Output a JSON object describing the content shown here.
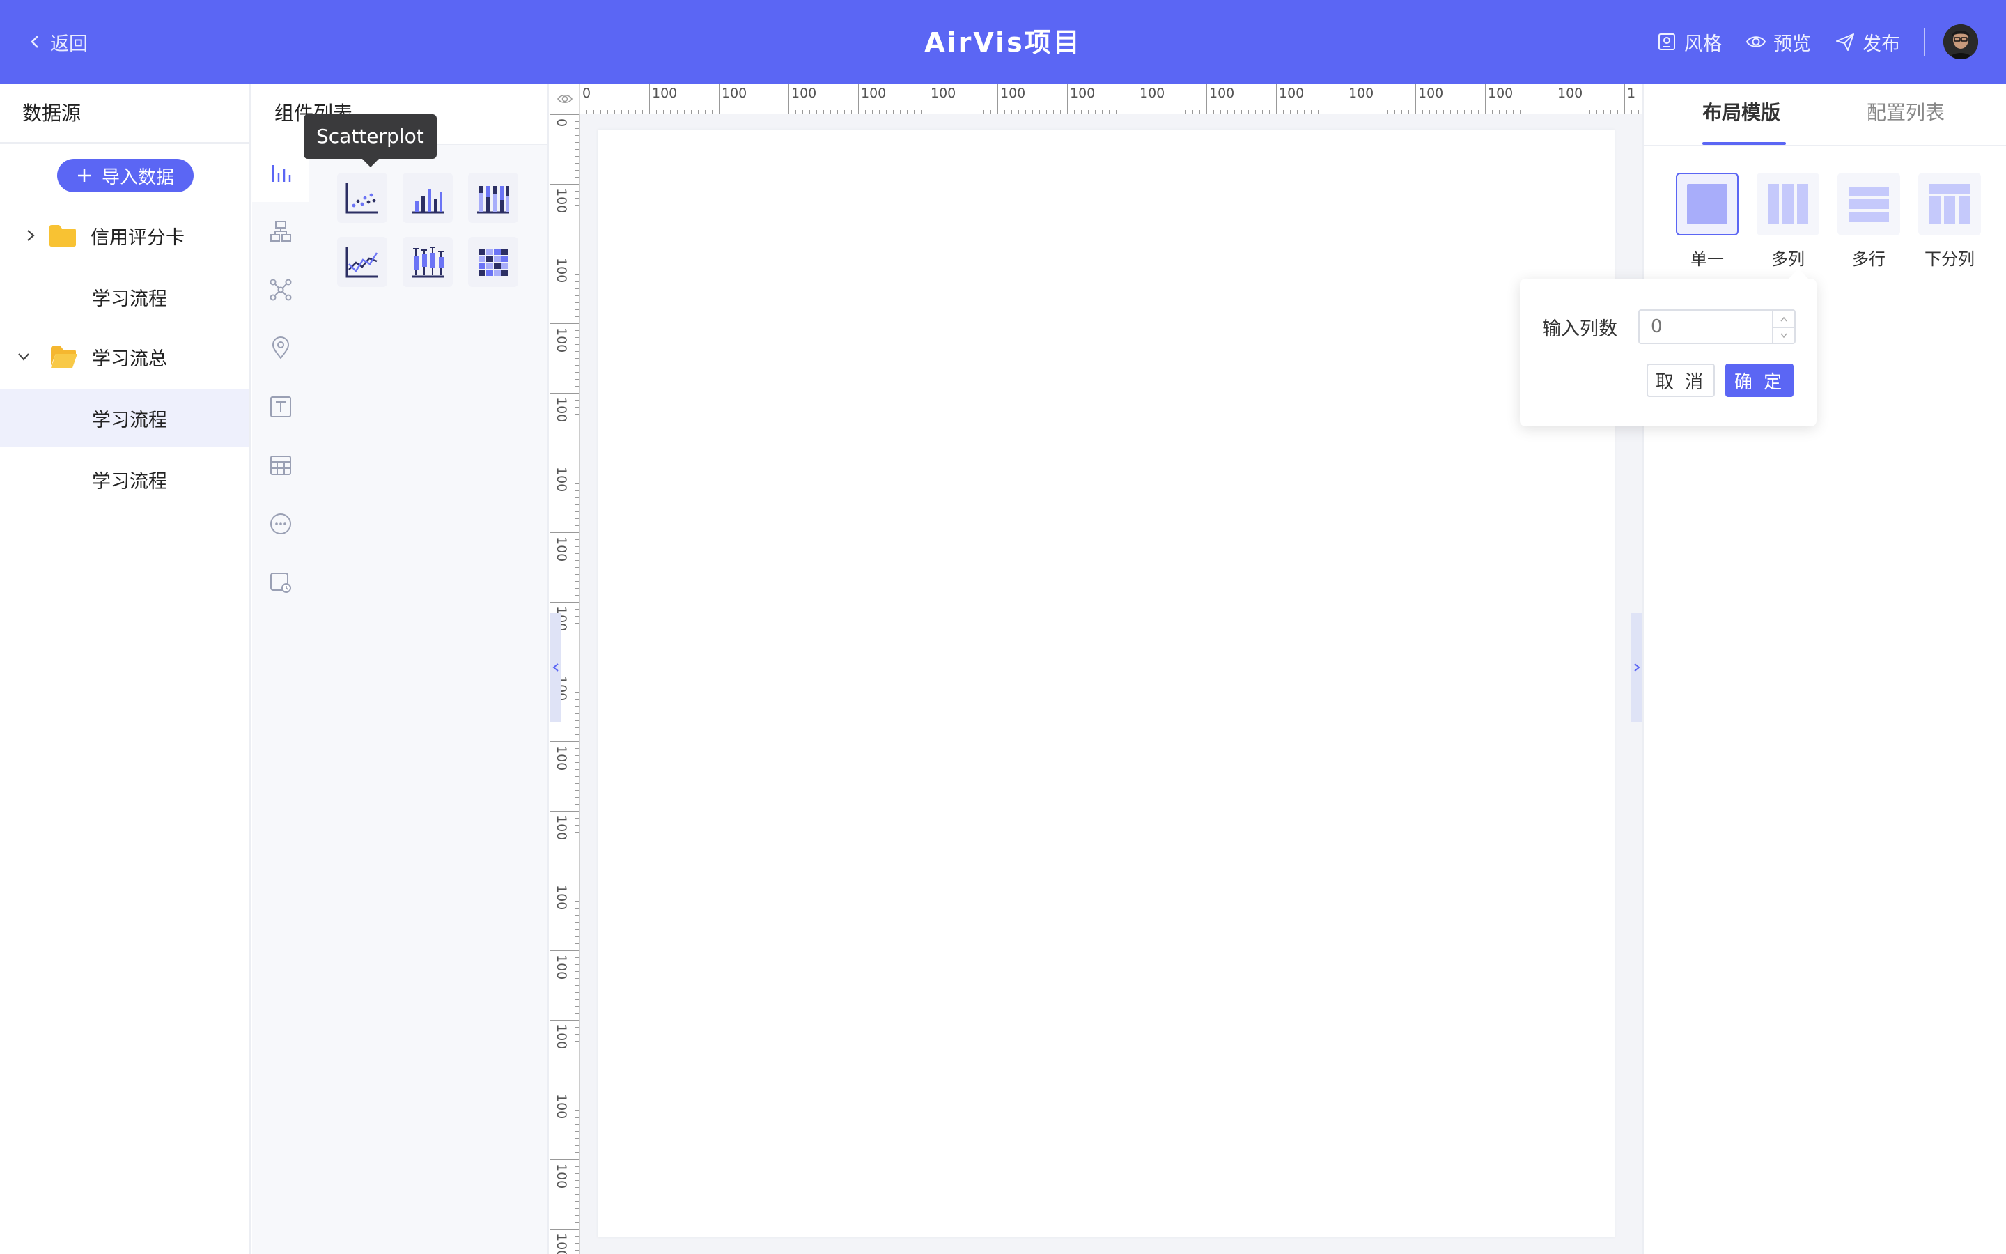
{
  "header": {
    "back_label": "返回",
    "title": "AirVis项目",
    "actions": [
      {
        "label": "风格",
        "icon": "style-icon"
      },
      {
        "label": "预览",
        "icon": "eye-icon"
      },
      {
        "label": "发布",
        "icon": "send-icon"
      }
    ],
    "accent_color": "#5b66f4"
  },
  "datasource": {
    "title": "数据源",
    "import_label": "导入数据",
    "tree": [
      {
        "label": "信用评分卡",
        "type": "folder",
        "expanded": false
      },
      {
        "label": "学习流程",
        "type": "item"
      },
      {
        "label": "学习流总",
        "type": "folder",
        "expanded": true
      },
      {
        "label": "学习流程",
        "type": "item",
        "selected": true
      },
      {
        "label": "学习流程",
        "type": "item"
      }
    ]
  },
  "components": {
    "title": "组件列表",
    "tooltip": "Scatterplot",
    "rail": [
      "bar-chart-icon",
      "hierarchy-icon",
      "network-icon",
      "map-pin-icon",
      "text-icon",
      "table-icon",
      "more-icon",
      "media-icon"
    ],
    "charts": [
      "scatterplot-icon",
      "bar-chart-icon",
      "stacked-bar-icon",
      "line-chart-icon",
      "boxplot-icon",
      "heatmap-icon"
    ]
  },
  "canvas": {
    "ruler_top_labels": [
      "0",
      "100",
      "100",
      "100",
      "100",
      "100",
      "100",
      "100",
      "100",
      "100",
      "100",
      "100",
      "100",
      "100",
      "100",
      "1"
    ],
    "ruler_left_labels": [
      "0",
      "100",
      "100",
      "100",
      "100",
      "100",
      "100",
      "100",
      "100",
      "100",
      "100",
      "100",
      "100",
      "100",
      "100",
      "100",
      "100"
    ]
  },
  "right_panel": {
    "tabs": [
      "布局模版",
      "配置列表"
    ],
    "active_tab": 0,
    "layouts": [
      {
        "label": "单一",
        "icon": "single-layout-icon",
        "selected": true
      },
      {
        "label": "多列",
        "icon": "multi-column-icon"
      },
      {
        "label": "多行",
        "icon": "multi-row-icon"
      },
      {
        "label": "下分列",
        "icon": "split-below-icon"
      }
    ]
  },
  "popover": {
    "label": "输入列数",
    "placeholder": "0",
    "cancel_label": "取 消",
    "ok_label": "确 定"
  }
}
